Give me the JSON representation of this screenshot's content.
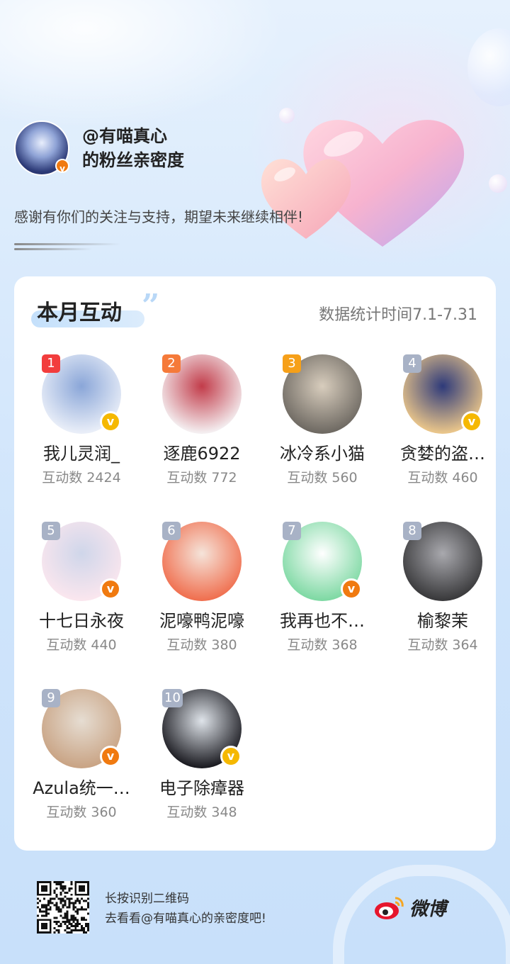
{
  "profile": {
    "handle_line": "@有喵真心",
    "subtitle_line": "的粉丝亲密度",
    "thanks": "感谢有你们的关注与支持，期望未来继续相伴!"
  },
  "card": {
    "title": "本月互动",
    "stat_time": "数据统计时间7.1-7.31"
  },
  "fans": [
    {
      "rank": "1",
      "name": "我儿灵润_",
      "count": "互动数 2424",
      "badge": "v",
      "badge_color": "yellow",
      "rank_color": "#f23d3d",
      "avatar_colors": [
        "#e9eef8",
        "#8aa6d8"
      ]
    },
    {
      "rank": "2",
      "name": "逐鹿6922",
      "count": "互动数 772",
      "badge": "",
      "badge_color": "",
      "rank_color": "#f57a3a",
      "avatar_colors": [
        "#f4eef0",
        "#c23c4a"
      ]
    },
    {
      "rank": "3",
      "name": "冰冷系小猫",
      "count": "互动数 560",
      "badge": "",
      "badge_color": "",
      "rank_color": "#f6a019",
      "avatar_colors": [
        "#6f6a63",
        "#d8cdbd"
      ]
    },
    {
      "rank": "4",
      "name": "贪婪的盗…",
      "count": "互动数 460",
      "badge": "v",
      "badge_color": "yellow",
      "rank_color": "#a8b2c6",
      "avatar_colors": [
        "#e9c58a",
        "#2e3a7a"
      ]
    },
    {
      "rank": "5",
      "name": "十七日永夜",
      "count": "互动数 440",
      "badge": "v",
      "badge_color": "orange",
      "rank_color": "#a8b2c6",
      "avatar_colors": [
        "#fae6ee",
        "#cfd6ea"
      ]
    },
    {
      "rank": "6",
      "name": "泥嚎鸭泥嚎",
      "count": "互动数 380",
      "badge": "",
      "badge_color": "",
      "rank_color": "#a8b2c6",
      "avatar_colors": [
        "#f07050",
        "#f5e4da"
      ]
    },
    {
      "rank": "7",
      "name": "我再也不…",
      "count": "互动数 368",
      "badge": "v",
      "badge_color": "orange",
      "rank_color": "#a8b2c6",
      "avatar_colors": [
        "#7fd9a4",
        "#ffffff"
      ]
    },
    {
      "rank": "8",
      "name": "榆黎茉",
      "count": "互动数 364",
      "badge": "",
      "badge_color": "",
      "rank_color": "#a8b2c6",
      "avatar_colors": [
        "#3a3a3c",
        "#a9a9ae"
      ]
    },
    {
      "rank": "9",
      "name": "Azula统一…",
      "count": "互动数 360",
      "badge": "v",
      "badge_color": "orange",
      "rank_color": "#a8b2c6",
      "avatar_colors": [
        "#c9a485",
        "#e6ddd2"
      ]
    },
    {
      "rank": "10",
      "name": "电子除瘴器",
      "count": "互动数 348",
      "badge": "v",
      "badge_color": "yellow",
      "rank_color": "#a8b2c6",
      "avatar_colors": [
        "#1c1c22",
        "#dfe4ea"
      ]
    }
  ],
  "footer": {
    "line1": "长按识别二维码",
    "line2": "去看看@有喵真心的亲密度吧!",
    "brand": "微博"
  }
}
